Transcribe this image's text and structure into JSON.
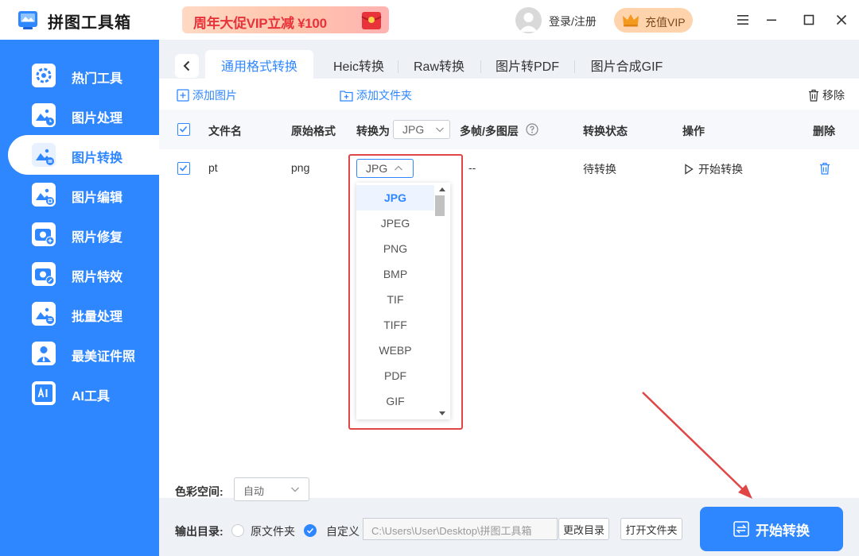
{
  "app": {
    "title": "拼图工具箱",
    "promo": "周年大促VIP立减 ¥100",
    "login": "登录/注册",
    "vip": "充值VIP"
  },
  "sidebar": {
    "items": [
      {
        "label": "热门工具",
        "icon": "gear-icon"
      },
      {
        "label": "图片处理",
        "icon": "image-clock-icon"
      },
      {
        "label": "图片转换",
        "icon": "image-convert-icon"
      },
      {
        "label": "图片编辑",
        "icon": "image-edit-icon"
      },
      {
        "label": "照片修复",
        "icon": "camera-plus-icon"
      },
      {
        "label": "照片特效",
        "icon": "camera-wand-icon"
      },
      {
        "label": "批量处理",
        "icon": "image-batch-icon"
      },
      {
        "label": "最美证件照",
        "icon": "id-photo-icon"
      },
      {
        "label": "AI工具",
        "icon": "ai-icon"
      }
    ]
  },
  "tabs": [
    "通用格式转换",
    "Heic转换",
    "Raw转换",
    "图片转PDF",
    "图片合成GIF"
  ],
  "toolbar": {
    "add_image": "添加图片",
    "add_folder": "添加文件夹",
    "remove": "移除"
  },
  "table": {
    "headers": {
      "filename": "文件名",
      "orig_format": "原始格式",
      "convert_to": "转换为",
      "convert_to_value": "JPG",
      "multiframe": "多帧/多图层",
      "status": "转换状态",
      "action": "操作",
      "delete": "删除"
    },
    "rows": [
      {
        "filename": "pt",
        "format": "png",
        "target": "JPG",
        "multiframe": "--",
        "status": "待转换",
        "action": "开始转换"
      }
    ]
  },
  "dropdown": {
    "options": [
      "JPG",
      "JPEG",
      "PNG",
      "BMP",
      "TIF",
      "TIFF",
      "WEBP",
      "PDF",
      "GIF"
    ],
    "selected": "JPG"
  },
  "bottom": {
    "color_space_label": "色彩空间:",
    "color_space_value": "自动",
    "output_label": "输出目录:",
    "option_original": "原文件夹",
    "option_custom": "自定义",
    "path": "C:\\Users\\User\\Desktop\\拼图工具箱",
    "change_dir": "更改目录",
    "open_folder": "打开文件夹",
    "start": "开始转换"
  },
  "colors": {
    "accent": "#2f87ff",
    "highlight_red": "#e04646",
    "vip_bg": "#ffd4ad"
  }
}
